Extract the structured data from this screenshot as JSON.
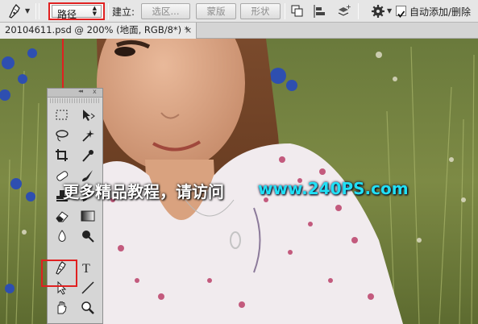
{
  "options_bar": {
    "mode_value": "路径",
    "make_label": "建立:",
    "selection_button": "选区...",
    "mask_button": "蒙版",
    "shape_button": "形状",
    "auto_add_delete_label": "自动添加/删除",
    "auto_add_delete_checked": true
  },
  "document_tab": {
    "title": "20104611.psd @ 200% (地面, RGB/8*) *",
    "close_glyph": "×"
  },
  "tools_panel": {
    "collapse_glyph": "◂◂",
    "close_glyph": "x",
    "active_tool": "pen-tool",
    "type_tool_glyph": "T"
  },
  "watermark": {
    "text": "更多精品教程，请访问",
    "url": "www.240PS.com",
    "url_color": "#21e0f5"
  },
  "colors": {
    "highlight": "#e02020",
    "annotation_line": "#e02020",
    "panel_bg": "#d6d6d6",
    "options_bg": "#e6e6e6"
  }
}
